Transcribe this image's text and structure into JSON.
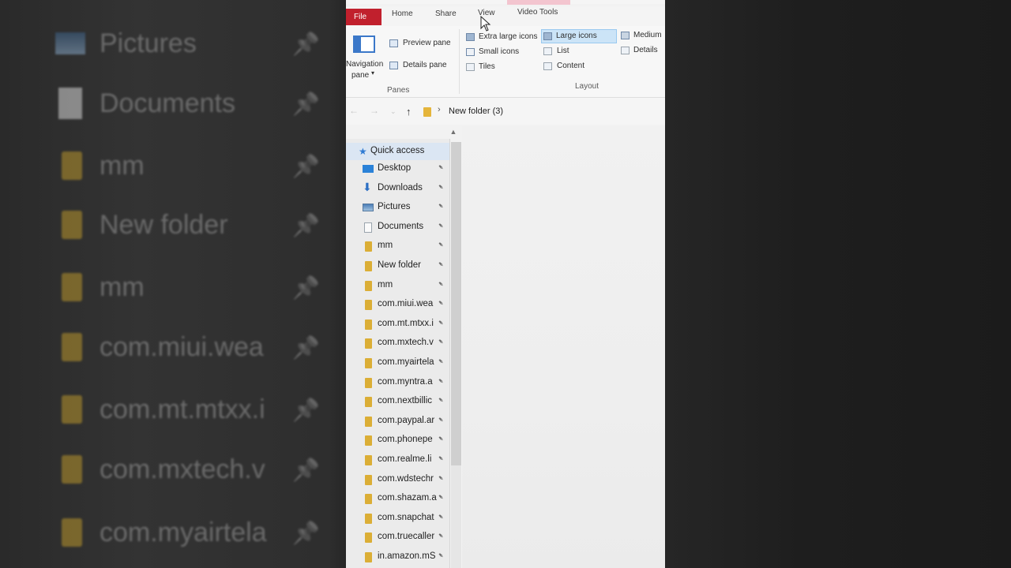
{
  "background_left": {
    "items": [
      {
        "label": "Pictures",
        "icon": "pictures-icon"
      },
      {
        "label": "Documents",
        "icon": "documents-icon"
      },
      {
        "label": "mm",
        "icon": "folder-icon"
      },
      {
        "label": "New folder",
        "icon": "folder-icon"
      },
      {
        "label": "mm",
        "icon": "folder-icon"
      },
      {
        "label": "com.miui.wea",
        "icon": "folder-icon"
      },
      {
        "label": "com.mt.mtxx.i",
        "icon": "folder-icon"
      },
      {
        "label": "com.mxtech.v",
        "icon": "folder-icon"
      },
      {
        "label": "com.myairtela",
        "icon": "folder-icon"
      }
    ]
  },
  "ribbon": {
    "tabs": {
      "file": "File",
      "home": "Home",
      "share": "Share",
      "view": "View",
      "video_tools": "Video Tools"
    },
    "panes": {
      "navigation_pane": "Navigation",
      "navigation_pane_2": "pane",
      "preview_pane": "Preview pane",
      "details_pane": "Details pane",
      "group_label": "Panes"
    },
    "layout": {
      "extra_large_icons": "Extra large icons",
      "large_icons": "Large icons",
      "medium": "Medium",
      "small_icons": "Small icons",
      "list": "List",
      "details": "Details",
      "tiles": "Tiles",
      "content": "Content",
      "group_label": "Layout"
    }
  },
  "address": {
    "path": "New folder (3)"
  },
  "nav_pane": {
    "quick_access": "Quick access",
    "items": [
      {
        "label": "Desktop",
        "icon": "desktop"
      },
      {
        "label": "Downloads",
        "icon": "downloads"
      },
      {
        "label": "Pictures",
        "icon": "pictures"
      },
      {
        "label": "Documents",
        "icon": "documents"
      },
      {
        "label": "mm",
        "icon": "folder"
      },
      {
        "label": "New folder",
        "icon": "folder"
      },
      {
        "label": "mm",
        "icon": "folder"
      },
      {
        "label": "com.miui.wea",
        "icon": "folder"
      },
      {
        "label": "com.mt.mtxx.i",
        "icon": "folder"
      },
      {
        "label": "com.mxtech.v",
        "icon": "folder"
      },
      {
        "label": "com.myairtela",
        "icon": "folder"
      },
      {
        "label": "com.myntra.a",
        "icon": "folder"
      },
      {
        "label": "com.nextbillic",
        "icon": "folder"
      },
      {
        "label": "com.paypal.ar",
        "icon": "folder"
      },
      {
        "label": "com.phonepe",
        "icon": "folder"
      },
      {
        "label": "com.realme.li",
        "icon": "folder"
      },
      {
        "label": "com.wdstechr",
        "icon": "folder"
      },
      {
        "label": "com.shazam.a",
        "icon": "folder"
      },
      {
        "label": "com.snapchat",
        "icon": "folder"
      },
      {
        "label": "com.truecaller",
        "icon": "folder"
      },
      {
        "label": "in.amazon.mS",
        "icon": "folder"
      }
    ]
  },
  "colors": {
    "file_tab": "#c1202d",
    "selection": "#cce4f7",
    "folder": "#dbae36",
    "accent": "#2b82d8"
  }
}
